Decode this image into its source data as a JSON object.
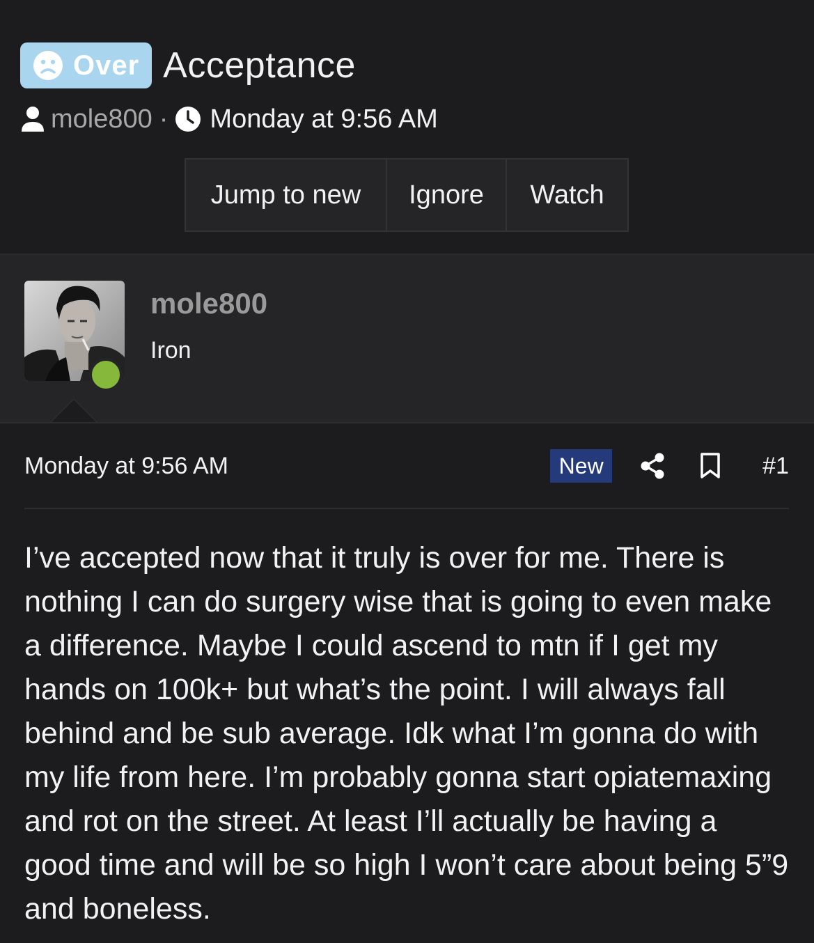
{
  "thread": {
    "prefix": "Over",
    "prefix_icon": "sad-face-icon",
    "title": "Acceptance",
    "author": "mole800",
    "separator": "·",
    "date": "Monday at 9:56 AM"
  },
  "actions": {
    "jump_label": "Jump to new",
    "ignore_label": "Ignore",
    "watch_label": "Watch"
  },
  "user": {
    "name": "mole800",
    "title": "Iron",
    "online": true
  },
  "post": {
    "date": "Monday at 9:56 AM",
    "badge": "New",
    "number": "#1",
    "body": "I’ve accepted now that it truly is over for me. There is nothing I can do surgery wise that is going to even make a difference. Maybe I could ascend to mtn if I get my hands on 100k+ but what’s the point. I will always fall behind and be sub average. Idk what I’m gonna do with my life from here. I’m probably gonna start opiatemaxing and rot on the street. At least I’ll actually be having a good time and will be so high I won’t care about being 5”9 and boneless."
  },
  "colors": {
    "background": "#1c1c1e",
    "panel": "#252527",
    "prefix_badge": "#a9d6ee",
    "new_badge": "#253a7a",
    "online": "#86b93b",
    "muted_text": "#a8a8a8"
  }
}
